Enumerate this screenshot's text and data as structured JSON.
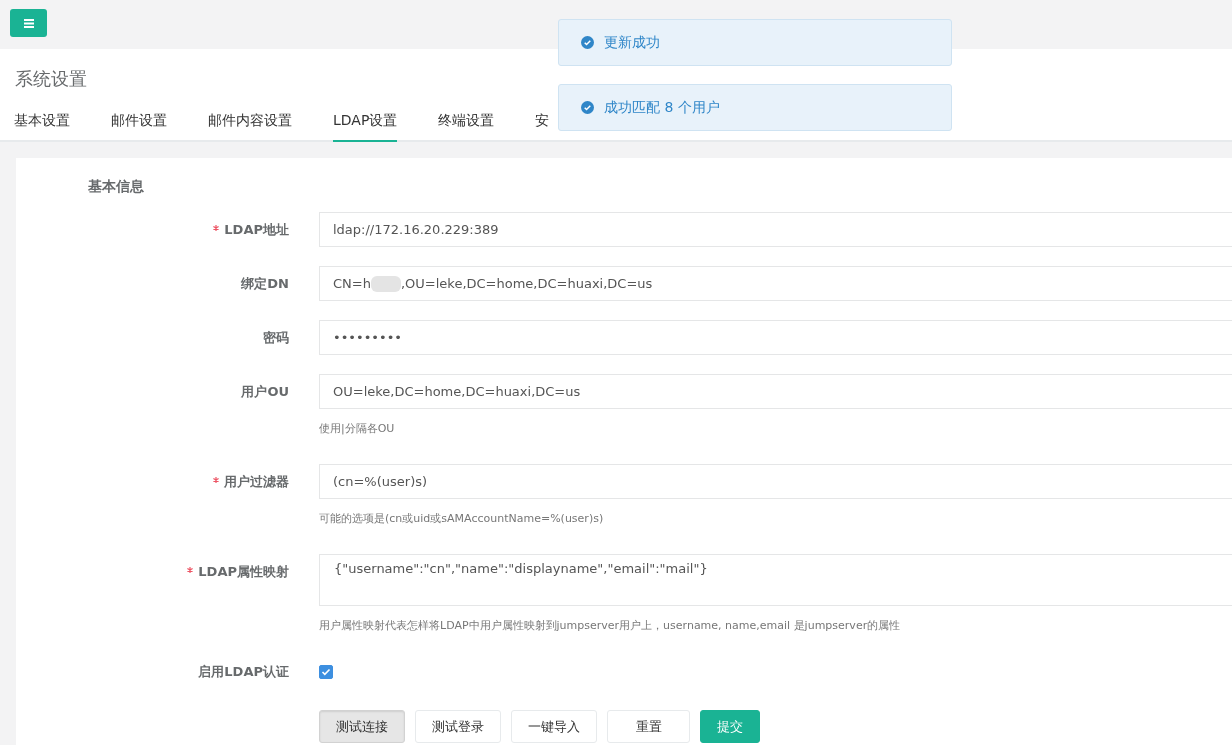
{
  "page_title": "系统设置",
  "tabs": [
    {
      "label": "基本设置",
      "selected": false
    },
    {
      "label": "邮件设置",
      "selected": false
    },
    {
      "label": "邮件内容设置",
      "selected": false
    },
    {
      "label": "LDAP设置",
      "selected": true
    },
    {
      "label": "终端设置",
      "selected": false
    },
    {
      "label": "安",
      "selected": false
    }
  ],
  "toasts": [
    {
      "message": "更新成功"
    },
    {
      "message": "成功匹配 8 个用户"
    }
  ],
  "section_title": "基本信息",
  "fields": [
    {
      "kind": "text",
      "label": "LDAP地址",
      "required": true,
      "value": "ldap://172.16.20.229:389"
    },
    {
      "kind": "redacted",
      "label": "绑定DN",
      "required": false,
      "value_start": "CN=h",
      "value_end": ",OU=leke,DC=home,DC=huaxi,DC=us"
    },
    {
      "kind": "text",
      "label": "密码",
      "required": false,
      "value": "•••••••••"
    },
    {
      "kind": "text",
      "label": "用户OU",
      "required": false,
      "value": "OU=leke,DC=home,DC=huaxi,DC=us",
      "help": "使用|分隔各OU"
    },
    {
      "kind": "text",
      "label": "用户过滤器",
      "required": true,
      "value": "(cn=%(user)s)",
      "help": "可能的选项是(cn或uid或sAMAccountName=%(user)s)"
    },
    {
      "kind": "textarea",
      "label": "LDAP属性映射",
      "required": true,
      "value": "{\"username\":\"cn\",\"name\":\"displayname\",\"email\":\"mail\"}",
      "help": "用户属性映射代表怎样将LDAP中用户属性映射到jumpserver用户上，username, name,email 是jumpserver的属性"
    },
    {
      "kind": "checkbox",
      "label": "启用LDAP认证",
      "required": false,
      "checked": true
    }
  ],
  "buttons": [
    {
      "label": "测试连接",
      "kind": "pressed"
    },
    {
      "label": "测试登录",
      "kind": "default"
    },
    {
      "label": "一键导入",
      "kind": "default"
    },
    {
      "label": "重置",
      "kind": "default"
    },
    {
      "label": "提交",
      "kind": "primary"
    }
  ]
}
